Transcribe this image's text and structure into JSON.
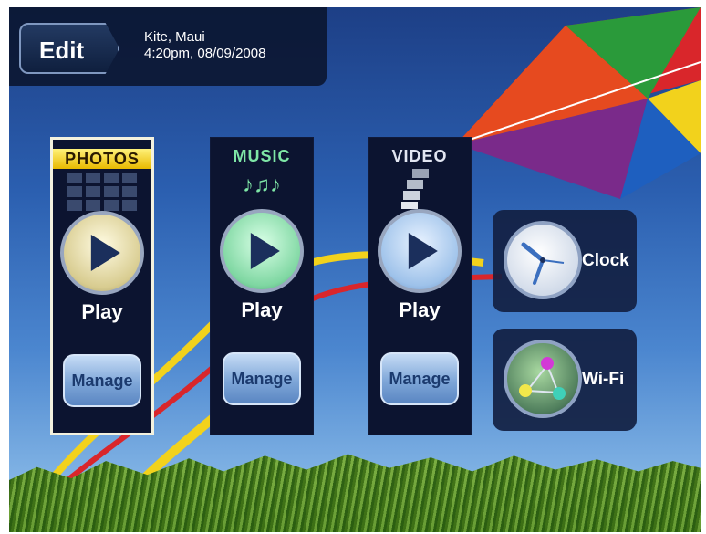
{
  "header": {
    "edit_label": "Edit",
    "info_line1": "Kite, Maui",
    "info_line2": "4:20pm, 08/09/2008"
  },
  "media": [
    {
      "title": "PHOTOS",
      "play_label": "Play",
      "manage_label": "Manage",
      "selected": true,
      "color": "#ffe14a"
    },
    {
      "title": "MUSIC",
      "play_label": "Play",
      "manage_label": "Manage",
      "selected": false,
      "color": "#7ee6a6"
    },
    {
      "title": "VIDEO",
      "play_label": "Play",
      "manage_label": "Manage",
      "selected": false,
      "color": "#e2e6f2"
    }
  ],
  "tiles": [
    {
      "label": "Clock",
      "icon": "clock-icon"
    },
    {
      "label": "Wi-Fi",
      "icon": "wifi-icon"
    }
  ],
  "icons": {
    "photos": "photo-grid-icon",
    "music": "music-notes-icon",
    "video": "film-stack-icon",
    "play": "play-icon"
  }
}
